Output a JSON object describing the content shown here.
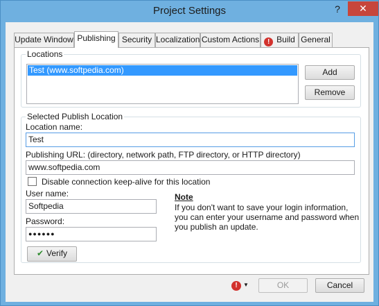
{
  "window": {
    "title": "Project Settings",
    "help_glyph": "?",
    "close_glyph": "✕"
  },
  "tabs": [
    {
      "label": "Update Window",
      "active": false
    },
    {
      "label": "Publishing",
      "active": true
    },
    {
      "label": "Security",
      "active": false
    },
    {
      "label": "Localization",
      "active": false
    },
    {
      "label": "Custom Actions",
      "active": false
    },
    {
      "label": "Build",
      "active": false,
      "icon": "warning-icon"
    },
    {
      "label": "General",
      "active": false
    }
  ],
  "locations": {
    "group_label": "Locations",
    "items": [
      "Test (www.softpedia.com)"
    ],
    "add_label": "Add",
    "remove_label": "Remove"
  },
  "selected": {
    "group_label": "Selected Publish Location",
    "location_name_label": "Location name:",
    "location_name_value": "Test",
    "url_label": "Publishing URL: (directory, network path, FTP directory, or HTTP directory)",
    "url_value": "www.softpedia.com",
    "keepalive_label": "Disable connection keep-alive for this location",
    "keepalive_checked": false,
    "username_label": "User name:",
    "username_value": "Softpedia",
    "password_label": "Password:",
    "password_value": "●●●●●●",
    "verify_label": "Verify",
    "note_title": "Note",
    "note_text": "If you don't want to save your login information, you can enter your username and password when you publish an update."
  },
  "footer": {
    "ok_label": "OK",
    "cancel_label": "Cancel",
    "warning_glyph": "!"
  },
  "icons": {
    "tab_warning": "!",
    "verify_check": "✔",
    "dropdown_caret": "▼"
  },
  "colors": {
    "titlebar": "#6fb0e0",
    "close": "#c7463c",
    "selection": "#3399ff",
    "warning": "#d2322d"
  }
}
